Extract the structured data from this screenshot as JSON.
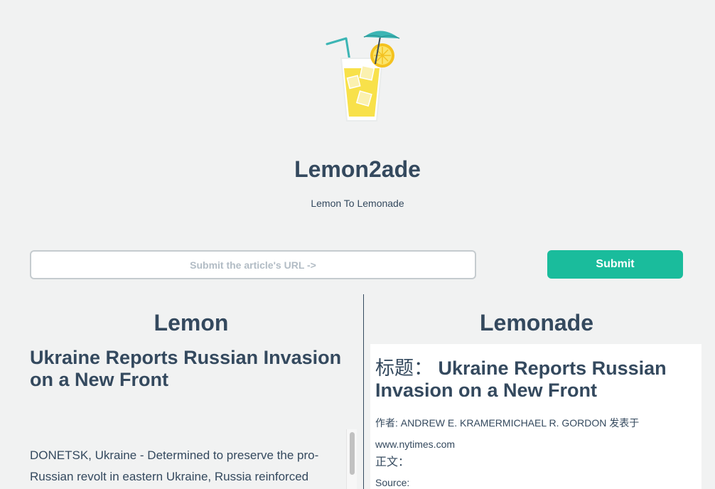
{
  "header": {
    "logo_icon": "lemonade-glass-icon",
    "title": "Lemon2ade",
    "tagline": "Lemon To Lemonade"
  },
  "form": {
    "url_placeholder": "Submit the article's URL ->",
    "url_value": "",
    "submit_label": "Submit"
  },
  "lemon": {
    "heading": "Lemon",
    "article_title": "Ukraine Reports Russian Invasion on a New Front",
    "article_body": "DONETSK, Ukraine - Determined to preserve the pro-Russian revolt in eastern Ukraine, Russia reinforced"
  },
  "lemonade": {
    "heading": "Lemonade",
    "title_label": "标题：",
    "article_title": "Ukraine Reports Russian Invasion on a New Front",
    "author_line": "作者: ANDREW E. KRAMERMICHAEL R. GORDON 发表于",
    "site": "www.nytimes.com",
    "body_label": "正文：",
    "source_label": "Source:"
  },
  "colors": {
    "text": "#34495e",
    "accent": "#1abc9c",
    "background": "#f1f2f2"
  }
}
